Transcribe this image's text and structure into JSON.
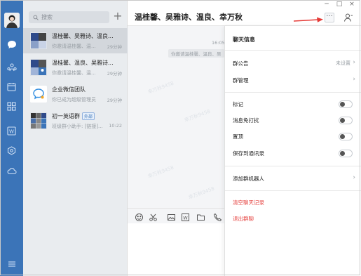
{
  "sidebar": {
    "avatar_icon": "user-avatar",
    "icons": [
      "chat-icon",
      "contacts-icon",
      "calendar-icon",
      "apps-icon",
      "doc-icon",
      "cube-icon",
      "cloud-icon",
      "menu-icon"
    ]
  },
  "chat_list": {
    "search_placeholder": "搜索",
    "add_label": "+",
    "items": [
      {
        "name": "温桂馨、吴雅诗、温良...",
        "preview": "你邀请温桂馨、温...",
        "time": "29分钟",
        "selected": true
      },
      {
        "name": "温桂馨、温良、吴雅诗...",
        "preview": "你邀请温桂馨、温...",
        "time": "29分钟",
        "selected": false
      },
      {
        "name": "企业微信团队",
        "preview": "你已成为超级管理员",
        "time": "29分钟",
        "selected": false
      },
      {
        "name": "初一英语群",
        "tag": "外部",
        "preview": "班级群小助手: [链接]...",
        "time": "10:22",
        "selected": false
      }
    ]
  },
  "chat": {
    "title": "温桂馨、吴雅诗、温良、幸万秋",
    "more_label": "···",
    "window_min": "−",
    "window_max": "□",
    "window_close": "×",
    "message_time": "16:05",
    "system_message": "你邀请温桂馨、温良、吴",
    "watermarks": [
      "幸万秋9458",
      "幸万秋9458",
      "幸万秋9458",
      "幸万秋9458"
    ]
  },
  "info_panel": {
    "title": "聊天信息",
    "announcement_label": "群公告",
    "announcement_value": "未设置",
    "manage_label": "群管理",
    "mark_label": "标记",
    "mute_label": "消息免打扰",
    "pin_label": "置顶",
    "save_contacts_label": "保存到通讯录",
    "add_bot_label": "添加群机器人",
    "clear_history_label": "清空聊天记录",
    "exit_group_label": "退出群聊"
  },
  "colors": {
    "accent": "#3b74b8",
    "danger": "#e64340",
    "arrow": "#e53935"
  }
}
